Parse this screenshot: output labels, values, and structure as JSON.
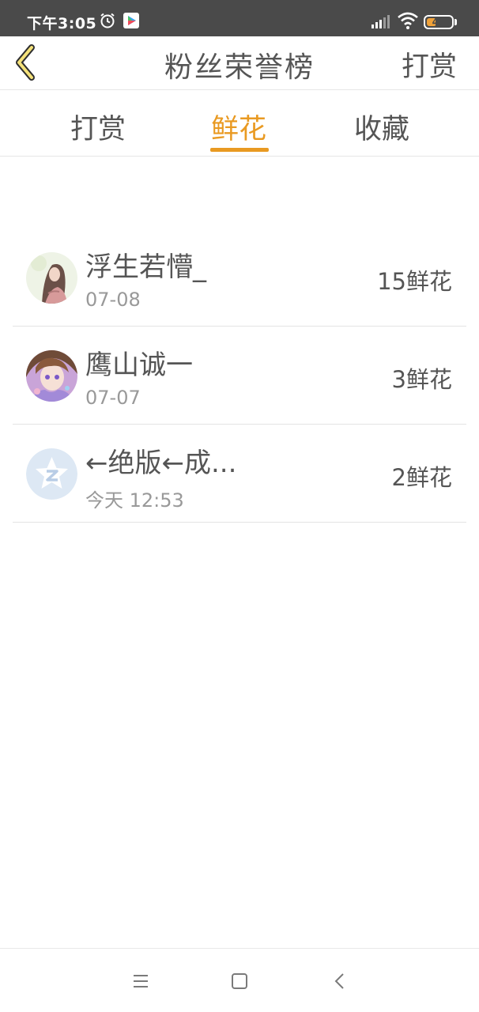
{
  "status_bar": {
    "time": "下午3:05",
    "battery": "40",
    "battery_level": 0.4,
    "icons": [
      "alarm-icon",
      "play-store-icon",
      "signal-icon",
      "wifi-icon",
      "battery-icon"
    ]
  },
  "header": {
    "back_icon": "chevron-left-icon",
    "title": "粉丝荣誉榜",
    "reward_label": "打赏"
  },
  "tabs": [
    {
      "label": "打赏",
      "active": false
    },
    {
      "label": "鲜花",
      "active": true
    },
    {
      "label": "收藏",
      "active": false
    }
  ],
  "accent_color": "#e99a22",
  "list": [
    {
      "name": "浮生若懵_",
      "date": "07-08",
      "count": "15鲜花",
      "avatar": "girl-portrait-avatar"
    },
    {
      "name": "鹰山诚一",
      "date": "07-07",
      "count": "3鲜花",
      "avatar": "anime-avatar"
    },
    {
      "name": "←绝版←成...",
      "date": "今天 12:53",
      "count": "2鲜花",
      "avatar": "qzone-star-avatar"
    }
  ],
  "system_nav": {
    "icons": [
      "menu-icon",
      "home-square-icon",
      "back-chevron-icon"
    ]
  }
}
